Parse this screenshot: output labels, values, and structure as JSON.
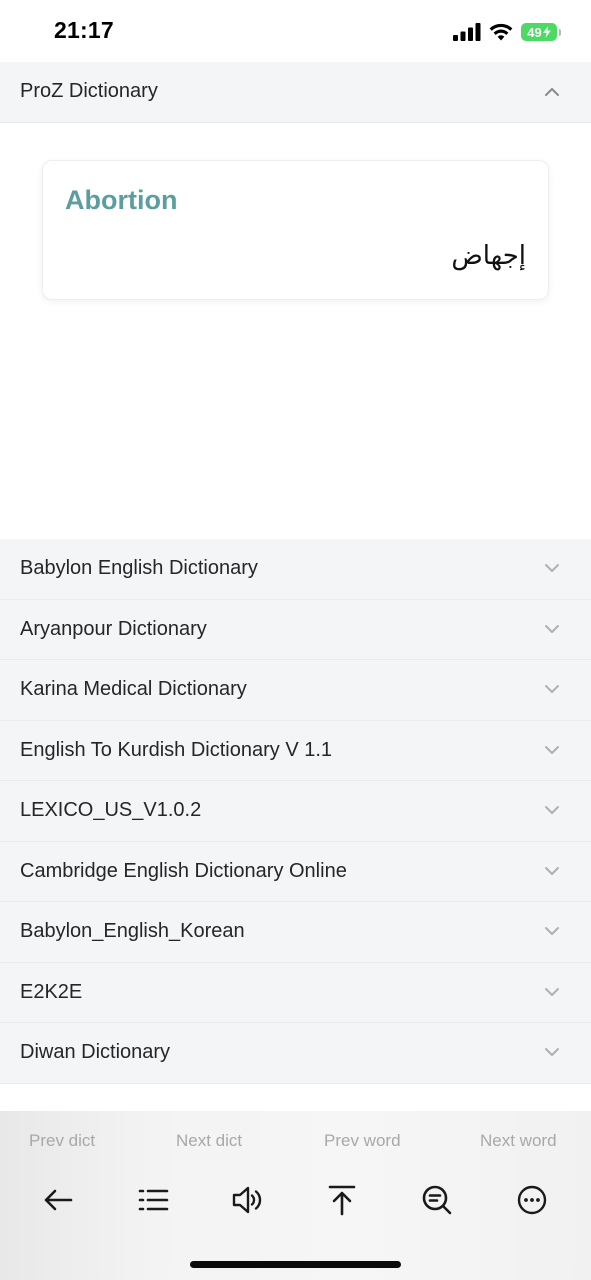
{
  "status_bar": {
    "time": "21:17",
    "battery_level": "49",
    "battery_color": "#4cd964",
    "icons": [
      "cellular-signal-icon",
      "wifi-icon",
      "battery-charging-icon"
    ]
  },
  "expanded_dictionary": {
    "title": "ProZ Dictionary",
    "entry": {
      "word": "Abortion",
      "translation": "إجهاض"
    },
    "accent_color": "#5c9ea0"
  },
  "dictionaries": [
    {
      "label": "Babylon English Dictionary"
    },
    {
      "label": "Aryanpour Dictionary"
    },
    {
      "label": "Karina Medical Dictionary"
    },
    {
      "label": "English To Kurdish Dictionary V 1.1"
    },
    {
      "label": "LEXICO_US_V1.0.2"
    },
    {
      "label": "Cambridge English Dictionary Online"
    },
    {
      "label": "Babylon_English_Korean"
    },
    {
      "label": "E2K2E"
    },
    {
      "label": "Diwan Dictionary"
    }
  ],
  "bottom_bar": {
    "nav": {
      "prev_dict": "Prev dict",
      "next_dict": "Next dict",
      "prev_word": "Prev word",
      "next_word": "Next word"
    },
    "tools": [
      "back-arrow-icon",
      "list-icon",
      "speaker-icon",
      "scroll-to-top-icon",
      "search-zoom-icon",
      "more-icon"
    ]
  }
}
